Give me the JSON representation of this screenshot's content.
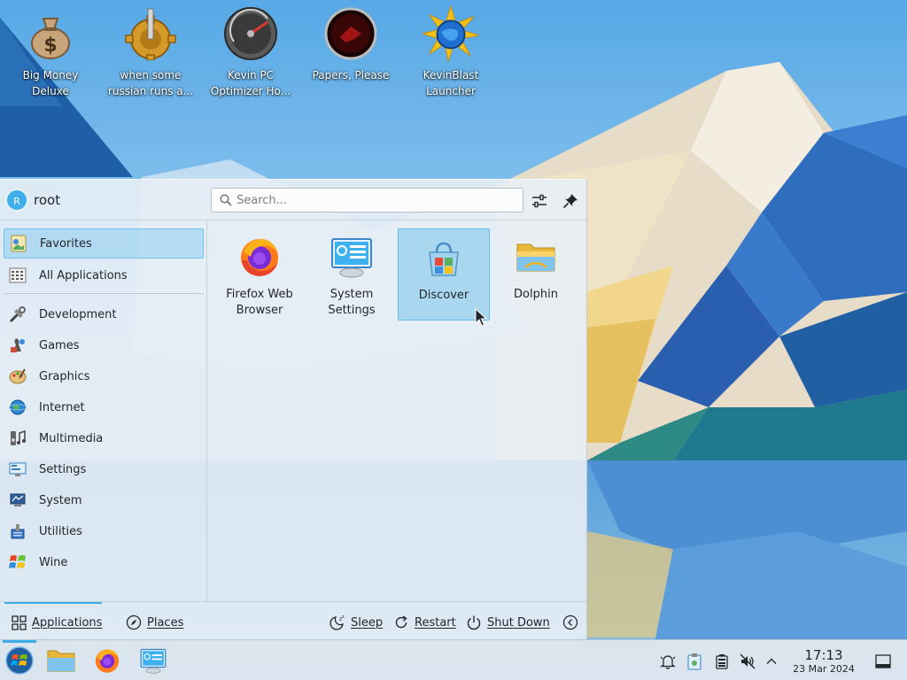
{
  "desktop": {
    "icons": [
      {
        "name": "money-bag-icon",
        "label": "Big Money\nDeluxe"
      },
      {
        "name": "gear-lever-icon",
        "label": "when some\nrussian runs a..."
      },
      {
        "name": "speedometer-icon",
        "label": "Kevin PC\nOptimizer Ho..."
      },
      {
        "name": "papers-please-icon",
        "label": "Papers, Please"
      },
      {
        "name": "blast-globe-icon",
        "label": "KevinBlast\nLauncher"
      }
    ]
  },
  "launcher": {
    "user": {
      "initial": "R",
      "name": "root"
    },
    "search": {
      "placeholder": "Search...",
      "value": ""
    },
    "sidebar": {
      "top": [
        {
          "label": "Favorites",
          "icon": "favorites-icon",
          "selected": true
        },
        {
          "label": "All Applications",
          "icon": "all-apps-icon",
          "selected": false
        }
      ],
      "categories": [
        {
          "label": "Development",
          "icon": "development-icon"
        },
        {
          "label": "Games",
          "icon": "games-icon"
        },
        {
          "label": "Graphics",
          "icon": "graphics-icon"
        },
        {
          "label": "Internet",
          "icon": "internet-icon"
        },
        {
          "label": "Multimedia",
          "icon": "multimedia-icon"
        },
        {
          "label": "Settings",
          "icon": "settings-icon"
        },
        {
          "label": "System",
          "icon": "system-icon"
        },
        {
          "label": "Utilities",
          "icon": "utilities-icon"
        },
        {
          "label": "Wine",
          "icon": "wine-icon"
        }
      ]
    },
    "favorites": [
      {
        "label": "Firefox Web Browser",
        "icon": "firefox-icon"
      },
      {
        "label": "System Settings",
        "icon": "system-settings-icon"
      },
      {
        "label": "Discover",
        "icon": "discover-icon",
        "hovered": true
      },
      {
        "label": "Dolphin",
        "icon": "dolphin-folder-icon"
      }
    ],
    "footer": {
      "applications": "Applications",
      "places": "Places",
      "sleep": "Sleep",
      "restart": "Restart",
      "shutdown": "Shut Down"
    }
  },
  "taskbar": {
    "pinned": [
      "start-menu-icon",
      "dolphin-icon",
      "firefox-icon",
      "system-settings-icon"
    ],
    "tray": [
      "notifications-icon",
      "clipboard-icon",
      "battery-icon",
      "volume-muted-icon",
      "expand-tray-icon"
    ],
    "clock": {
      "time": "17:13",
      "date": "23 Mar 2024"
    }
  },
  "colors": {
    "accent": "#3daee9",
    "text": "#232629"
  }
}
